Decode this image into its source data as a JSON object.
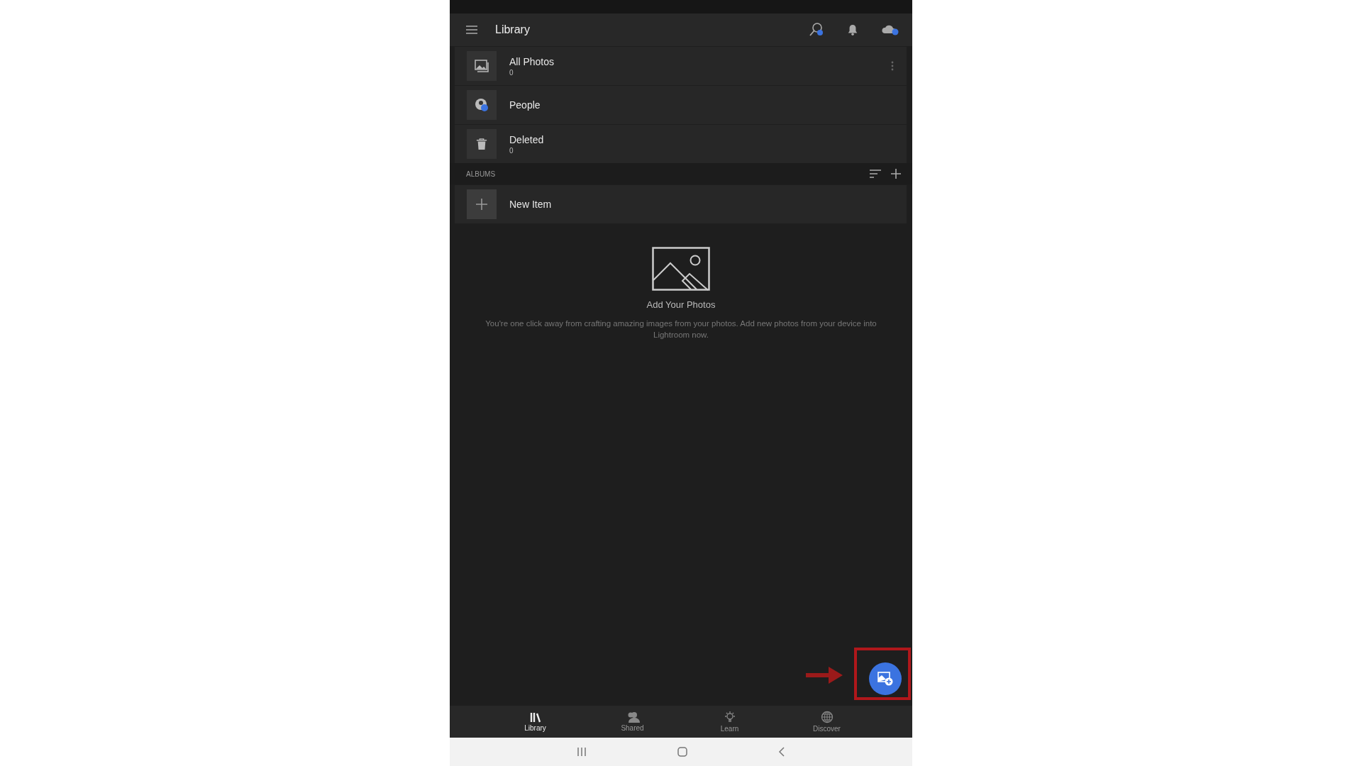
{
  "header": {
    "title": "Library"
  },
  "library_items": [
    {
      "kind": "photos",
      "label": "All Photos",
      "count": "0",
      "more_menu": true
    },
    {
      "kind": "people",
      "label": "People",
      "more_menu": false
    },
    {
      "kind": "deleted",
      "label": "Deleted",
      "count": "0",
      "more_menu": false
    }
  ],
  "albums": {
    "heading": "ALBUMS",
    "items": [
      {
        "label": "New Item"
      }
    ]
  },
  "empty_state": {
    "title": "Add Your Photos",
    "message": "You're one click away from crafting amazing images from your photos. Add new photos from your device into Lightroom now."
  },
  "tabs": [
    {
      "kind": "library",
      "label": "Library",
      "selected": true
    },
    {
      "kind": "shared",
      "label": "Shared",
      "selected": false
    },
    {
      "kind": "learn",
      "label": "Learn",
      "selected": false
    },
    {
      "kind": "discover",
      "label": "Discover",
      "selected": false
    }
  ]
}
